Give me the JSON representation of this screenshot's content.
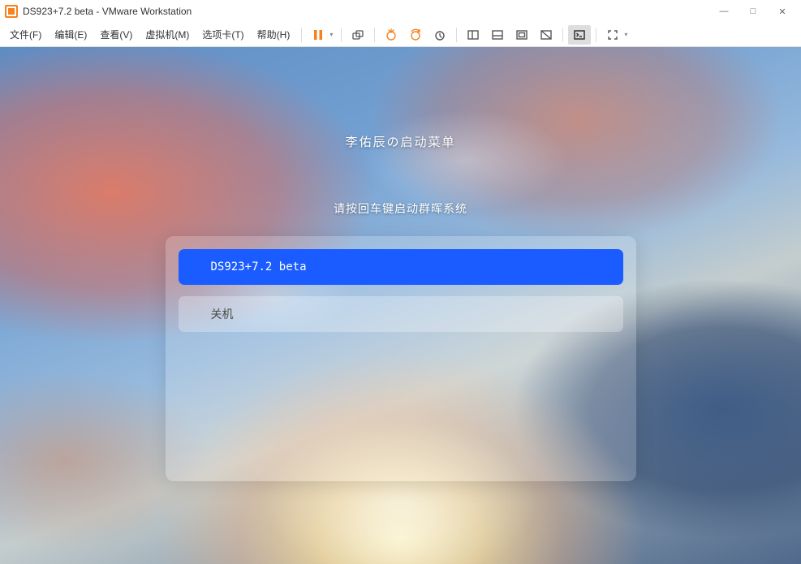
{
  "window": {
    "title": "DS923+7.2 beta - VMware Workstation"
  },
  "menu": {
    "file": "文件(F)",
    "edit": "编辑(E)",
    "view": "查看(V)",
    "vm": "虚拟机(M)",
    "tabs": "选项卡(T)",
    "help": "帮助(H)"
  },
  "window_controls": {
    "minimize": "—",
    "maximize": "□",
    "close": "✕"
  },
  "boot": {
    "title": "李佑辰の启动菜单",
    "subtitle": "请按回车键启动群晖系统",
    "options": [
      {
        "label": "DS923+7.2 beta",
        "selected": true
      },
      {
        "label": "关机",
        "selected": false
      }
    ]
  }
}
